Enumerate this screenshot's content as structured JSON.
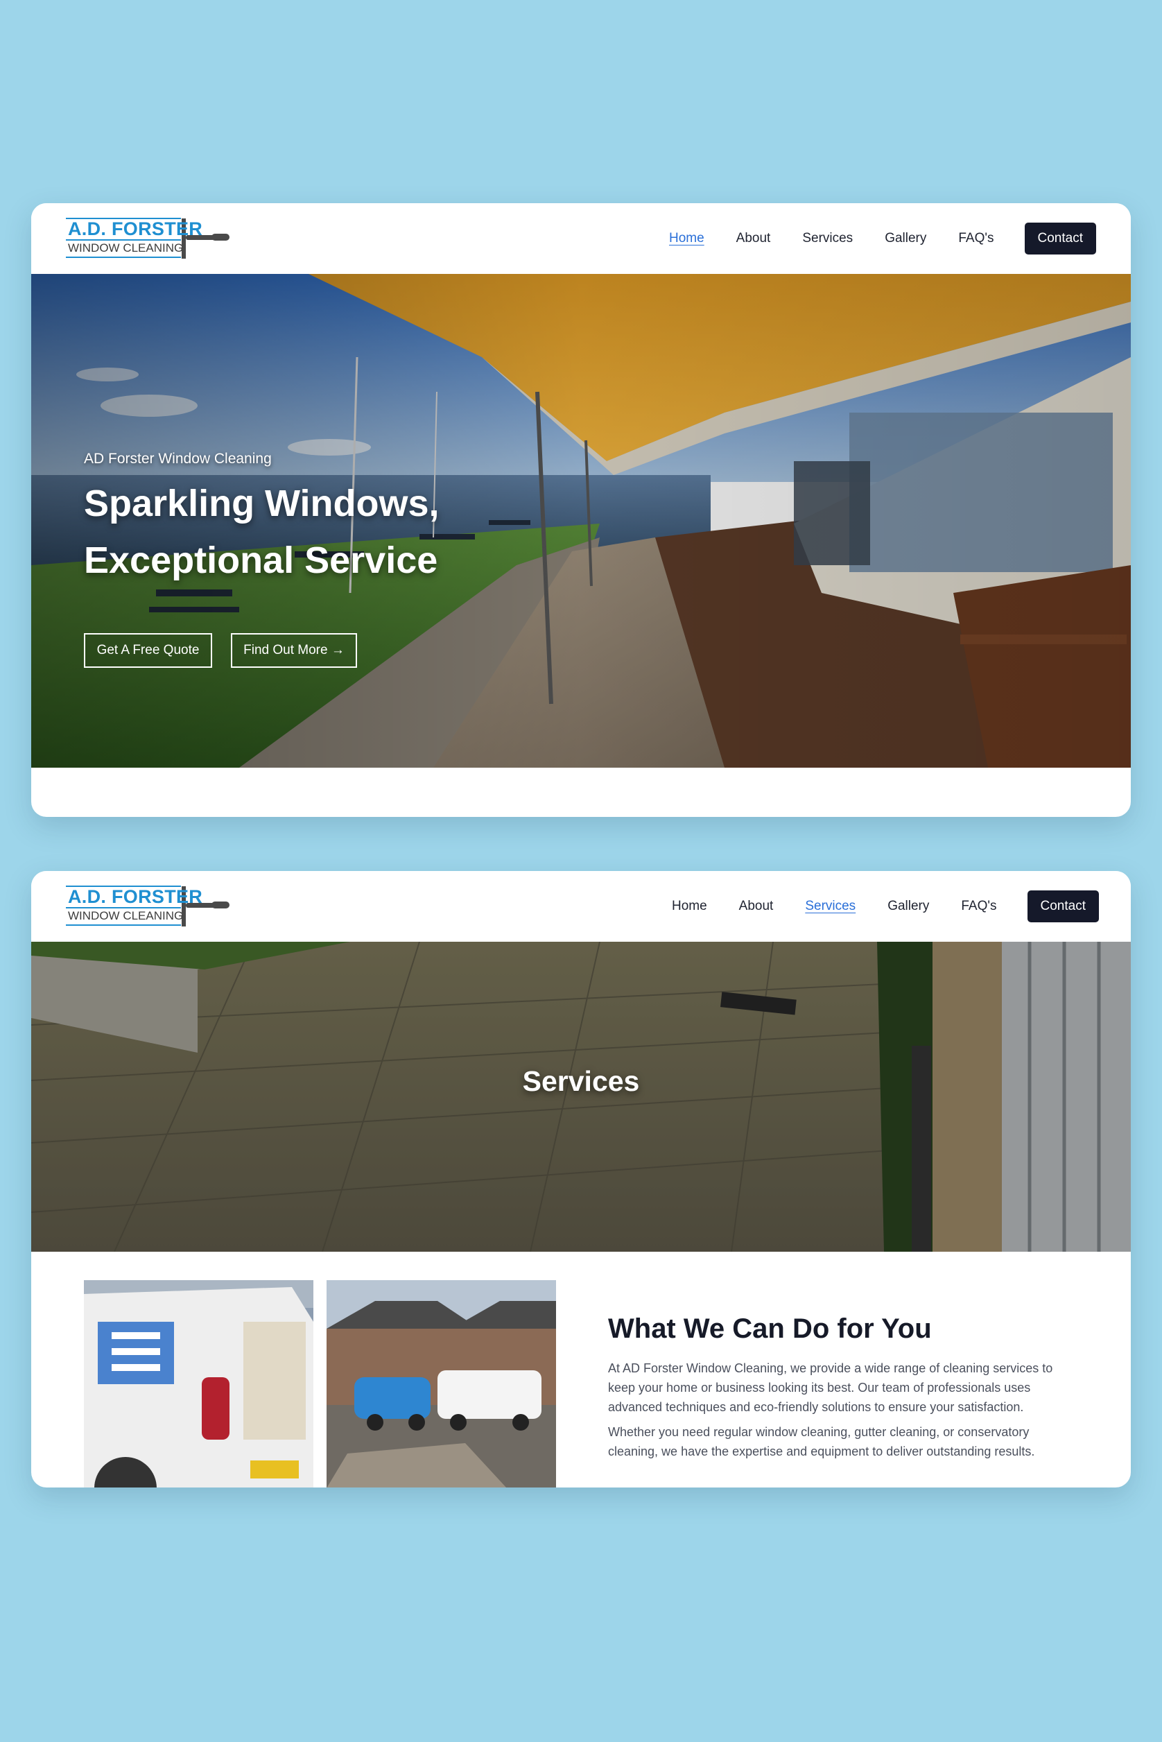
{
  "colors": {
    "background": "#9dd5ea",
    "accent": "#2a6fd8",
    "logo_blue": "#1f8fd1",
    "contact_button": "#15192a"
  },
  "logo": {
    "line1": "A.D. FORSTER",
    "line2": "WINDOW CLEANING",
    "icon": "squeegee-icon"
  },
  "page1": {
    "nav": {
      "items": [
        {
          "label": "Home",
          "active": true
        },
        {
          "label": "About",
          "active": false
        },
        {
          "label": "Services",
          "active": false
        },
        {
          "label": "Gallery",
          "active": false
        },
        {
          "label": "FAQ's",
          "active": false
        }
      ],
      "contact_label": "Contact"
    },
    "hero": {
      "subtitle": "AD Forster Window Cleaning",
      "title": "Sparkling Windows, Exceptional Service",
      "quote_button": "Get A Free Quote",
      "more_button": "Find Out More →"
    }
  },
  "page2": {
    "nav": {
      "items": [
        {
          "label": "Home",
          "active": false
        },
        {
          "label": "About",
          "active": false
        },
        {
          "label": "Services",
          "active": true
        },
        {
          "label": "Gallery",
          "active": false
        },
        {
          "label": "FAQ's",
          "active": false
        }
      ],
      "contact_label": "Contact"
    },
    "hero": {
      "title": "Services"
    },
    "content": {
      "title": "What We Can Do for You",
      "paragraph1": "At AD Forster Window Cleaning, we provide a wide range of cleaning services to keep your home or business looking its best. Our team of professionals uses advanced techniques and eco-friendly solutions to ensure your satisfaction.",
      "paragraph2": "Whether you need regular window cleaning, gutter cleaning, or conservatory cleaning, we have the expertise and equipment to deliver outstanding results."
    }
  }
}
